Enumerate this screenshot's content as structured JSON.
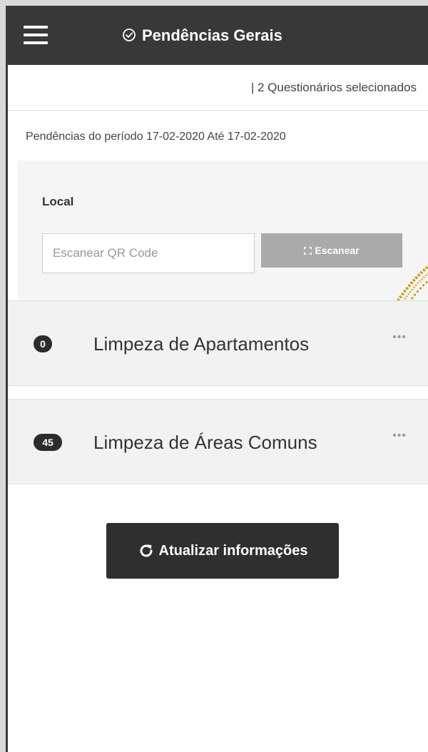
{
  "header": {
    "menu_icon": "hamburger-menu-icon",
    "title_icon": "check-circle-icon",
    "title": "Pendências Gerais"
  },
  "selection": {
    "text": "| 2 Questionários selecionados"
  },
  "period": {
    "text": "Pendências do período 17-02-2020 Até 17-02-2020"
  },
  "local": {
    "label": "Local",
    "qr_placeholder": "Escanear QR Code",
    "qr_value": "",
    "scan_icon": "qr-scan-icon",
    "scan_label": "Escanear"
  },
  "items": [
    {
      "count": "0",
      "title": "Limpeza de Apartamentos",
      "more": "•••"
    },
    {
      "count": "45",
      "title": "Limpeza de Áreas Comuns",
      "more": "•••"
    }
  ],
  "update": {
    "icon": "refresh-icon",
    "label": "Atualizar informações"
  },
  "colors": {
    "header_bg": "#383838",
    "badge_bg": "#2c2c2c",
    "scan_button_bg": "#aaaaaa",
    "update_button_bg": "#2f2f2f",
    "item_bg": "#f2f2f2",
    "swoosh_gold": "#c8a11a"
  }
}
